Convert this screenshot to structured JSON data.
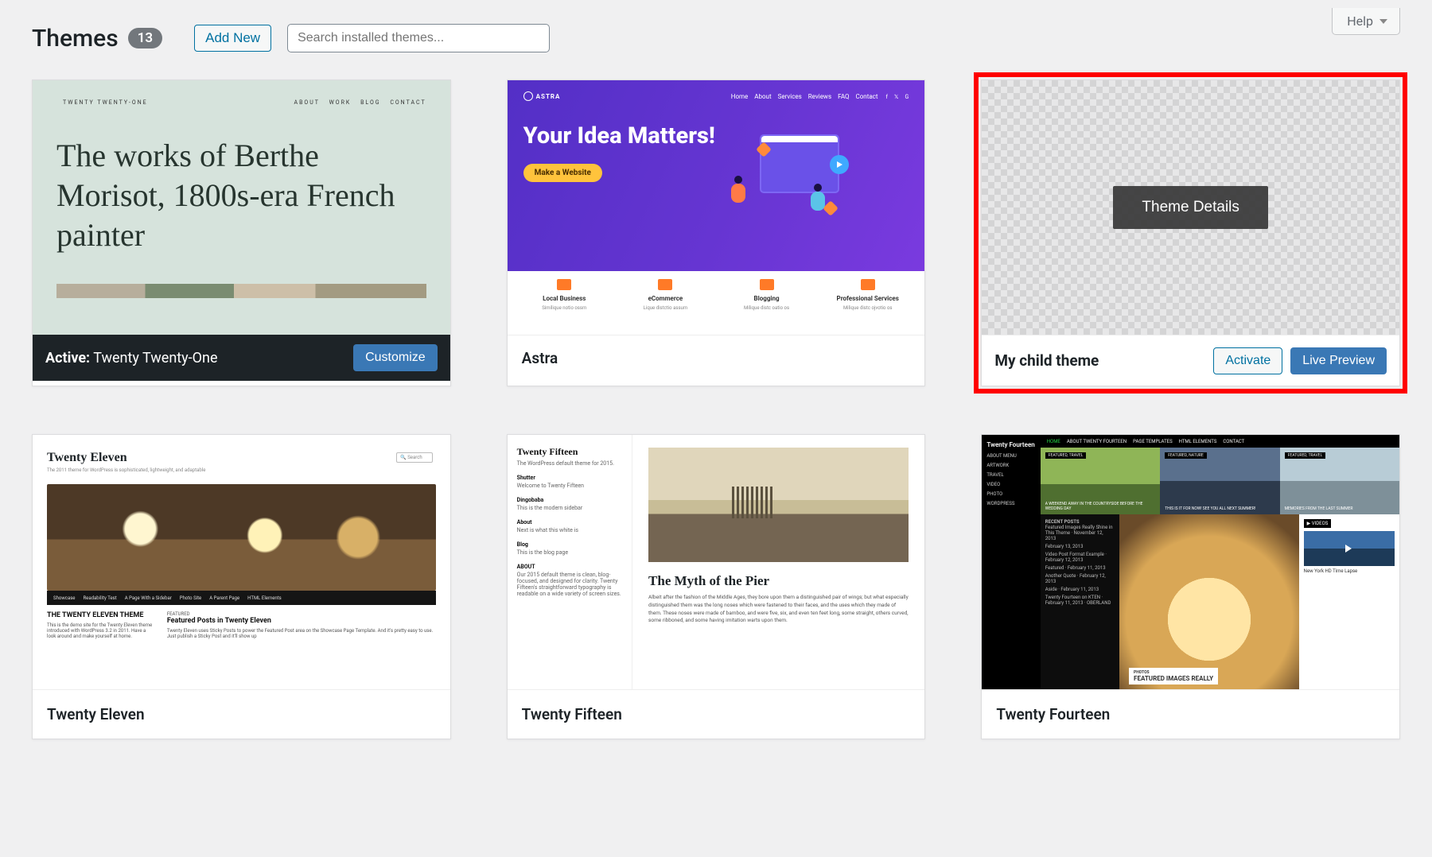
{
  "header": {
    "title": "Themes",
    "count": "13",
    "add_new": "Add New",
    "search_placeholder": "Search installed themes...",
    "help": "Help"
  },
  "active_theme": {
    "prefix": "Active:",
    "name": "Twenty Twenty-One",
    "customize": "Customize",
    "preview": {
      "site_name": "TWENTY TWENTY-ONE",
      "nav": [
        "ABOUT",
        "WORK",
        "BLOG",
        "CONTACT"
      ],
      "headline": "The works of Berthe Morisot, 1800s-era French painter"
    }
  },
  "middle_theme_details": "Theme Details",
  "child": {
    "name": "My child theme",
    "activate": "Activate",
    "live_preview": "Live Preview"
  },
  "themes": [
    {
      "name": "Astra",
      "hero": "Your Idea Matters!",
      "cta": "Make a Website",
      "nav": [
        "Home",
        "About",
        "Services",
        "Reviews",
        "FAQ",
        "Contact"
      ],
      "cols": [
        {
          "t": "Local Business",
          "s": "Similique notio ossm"
        },
        {
          "t": "eCommerce",
          "s": "Lique distctio assum"
        },
        {
          "t": "Blogging",
          "s": "Milique distc oatio os"
        },
        {
          "t": "Professional Services",
          "s": "Milique distc ojvotio os"
        }
      ]
    },
    {
      "name": "Twenty Eleven",
      "site": "Twenty Eleven",
      "tag": "The 2011 theme for WordPress is sophisticated, lightweight, and adaptable",
      "search": "Search",
      "nav": [
        "Showcase",
        "Readability Test",
        "A Page With a Sidebar",
        "Photo Site",
        "A Parent Page",
        "HTML Elements"
      ],
      "left_head": "THE TWENTY ELEVEN THEME",
      "left_body": "This is the demo site for the Twenty Eleven theme introduced with WordPress 3.2 in 2011. Have a look around and make yourself at home.",
      "right_label": "FEATURED",
      "right_head": "Featured Posts in Twenty Eleven",
      "right_body": "Twenty Eleven uses Sticky Posts to power the Featured Post area on the Showcase Page Template. And it's pretty easy to use. Just publish a Sticky Post and it'll show up"
    },
    {
      "name": "Twenty Fifteen",
      "site": "Twenty Fifteen",
      "tag": "The WordPress default theme for 2015.",
      "blocks": [
        {
          "h": "Shutter",
          "b": "Welcome to Twenty Fifteen"
        },
        {
          "h": "Dingobaba",
          "b": "This is the modern sidebar"
        },
        {
          "h": "About",
          "b": "Next is what this white is"
        },
        {
          "h": "Blog",
          "b": "This is the blog page"
        }
      ],
      "about_head": "ABOUT",
      "about": "Our 2015 default theme is clean, blog-focused, and designed for clarity. Twenty Fifteen's straightforward typography is readable on a wide variety of screen sizes.",
      "article_title": "The Myth of the Pier",
      "article_body": "Albeit after the fashion of the Middle Ages, they bore upon them a distinguished pair of wings; but what especially distinguished them was the long noses which were fastened to their faces, and the uses which they made of them. These noses were made of bamboo, and were five, six, and even ten feet long, some straight, others curved, some ribboned, and some having imitation warts upon them."
    },
    {
      "name": "Twenty Fourteen",
      "site": "Twenty Fourteen",
      "nav": [
        "HOME",
        "ABOUT TWENTY FOURTEEN",
        "PAGE TEMPLATES",
        "HTML ELEMENTS",
        "CONTACT"
      ],
      "side": [
        "ABOUT MENU",
        "ARTWORK",
        "TRAVEL",
        "VIDEO",
        "PHOTO",
        "WORDPRESS"
      ],
      "tiles": [
        {
          "tag": "FEATURED, TRAVEL",
          "cap": "A WEEKEND AWAY IN THE COUNTRYSIDE BEFORE THE WEDDING DAY"
        },
        {
          "tag": "FEATURED, NATURE",
          "cap": "THIS IS IT FOR NOW! SEE YOU ALL NEXT SUMMER!"
        },
        {
          "tag": "FEATURED, TRAVEL",
          "cap": "MEMORIES FROM THE LAST SUMMER"
        }
      ],
      "recent_head": "RECENT POSTS",
      "recent": [
        "Featured Images Really Shine in This Theme · November 12, 2013",
        "February 13, 2013",
        "Video Post Format Example · February 12, 2013",
        "Featured · February 11, 2013",
        "Another Quote · February 12, 2013",
        "Aside · February 11, 2013",
        "Twenty Fourteen on KTEN · February 11, 2013 · OBERLAND"
      ],
      "videos": "VIDEOS",
      "video_title": "New York HD Time Lapse",
      "photo_tag": "PHOTOS",
      "photo_cap": "FEATURED IMAGES REALLY"
    }
  ]
}
